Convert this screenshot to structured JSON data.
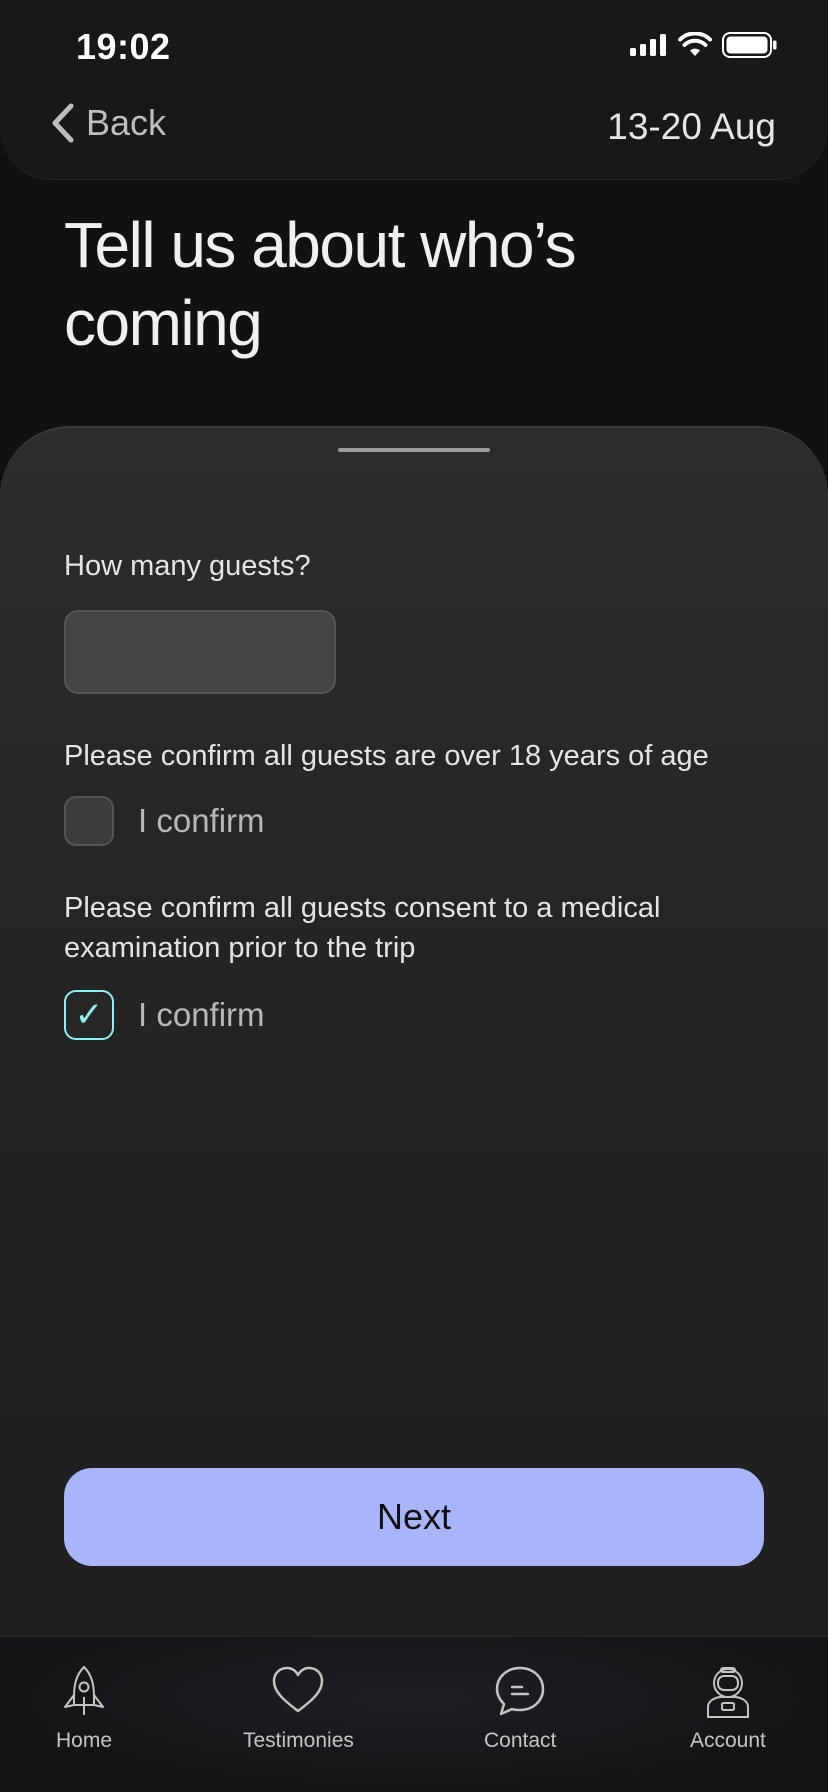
{
  "status_bar": {
    "time": "19:02"
  },
  "header": {
    "back_label": "Back",
    "date_range": "13-20 Aug"
  },
  "title": {
    "line1": "Tell us about who’s",
    "line2": "coming"
  },
  "form": {
    "guests_label": "How many guests?",
    "guests_value": "",
    "age_label": "Please confirm all guests are over 18 years of age",
    "age_confirm_label": "I confirm",
    "age_confirmed": false,
    "medical_label_line1": "Please confirm all guests consent to a medical",
    "medical_label_line2": "examination prior to the trip",
    "medical_confirm_label": "I confirm",
    "medical_confirmed": true,
    "next_label": "Next"
  },
  "tabbar": {
    "items": [
      {
        "label": "Home",
        "icon": "rocket-icon"
      },
      {
        "label": "Testimonies",
        "icon": "heart-icon"
      },
      {
        "label": "Contact",
        "icon": "chat-bubble-icon"
      },
      {
        "label": "Account",
        "icon": "astronaut-icon"
      }
    ]
  },
  "colors": {
    "accent_button": "#a9b5fb",
    "checkbox_checked": "#8ef0f0",
    "background": "#111111",
    "sheet": "#2a2a2a"
  }
}
